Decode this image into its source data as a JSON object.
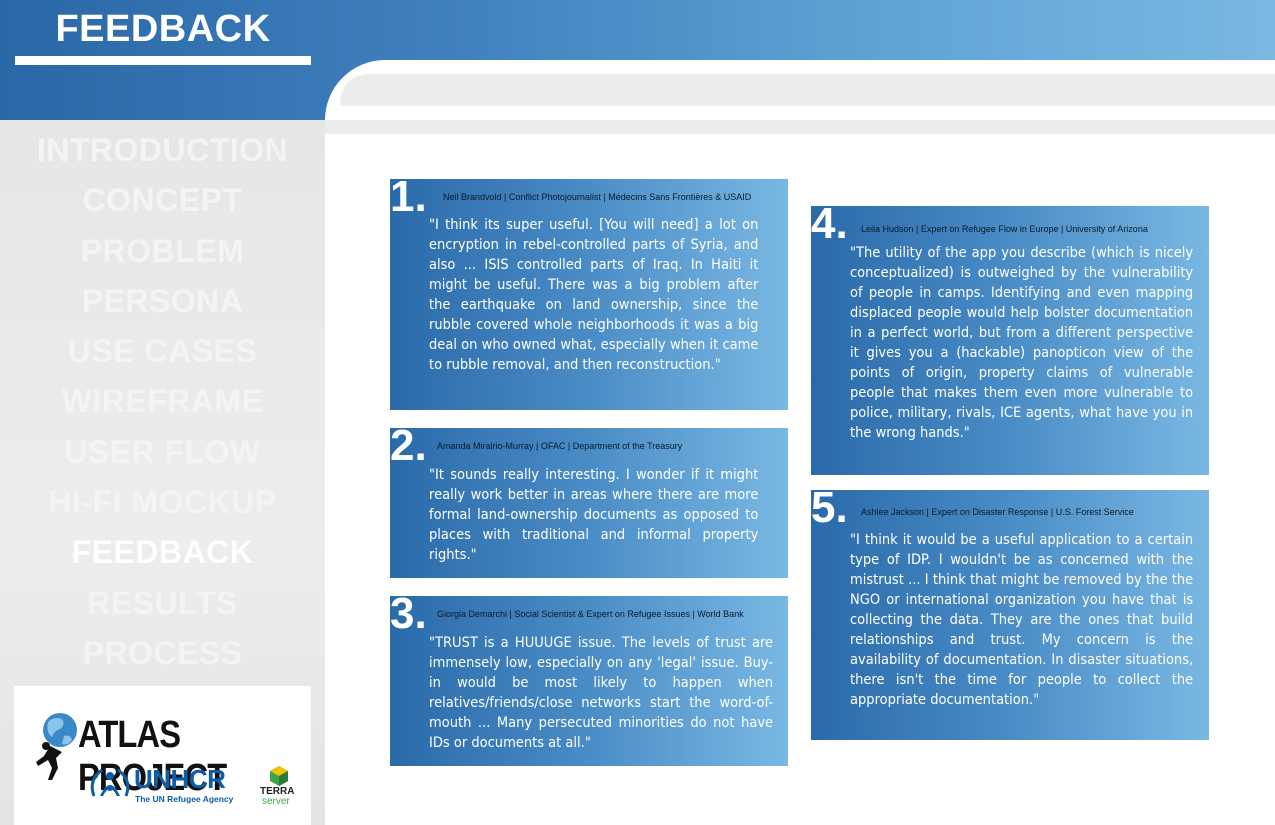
{
  "header": {
    "title": "FEEDBACK"
  },
  "sidebar": {
    "items": [
      {
        "label": "INTRODUCTION"
      },
      {
        "label": "CONCEPT"
      },
      {
        "label": "PROBLEM"
      },
      {
        "label": "PERSONA"
      },
      {
        "label": "USE CASES"
      },
      {
        "label": "WIREFRAME"
      },
      {
        "label": "USER FLOW"
      },
      {
        "label": "HI-FI MOCKUP"
      },
      {
        "label": "FEEDBACK",
        "active": true
      },
      {
        "label": "RESULTS"
      },
      {
        "label": "PROCESS"
      }
    ],
    "logos": {
      "atlas": "ATLAS PROJECT",
      "unhcr": "UNHCR",
      "unhcr_sub": "The UN Refugee Agency",
      "terra_line1": "TERRA",
      "terra_line2": "server"
    }
  },
  "colors": {
    "header_gradient_start": "#2a67a6",
    "header_gradient_end": "#7bb8e2",
    "card_gradient_start": "#2a6aa9",
    "card_gradient_end": "#7ab8e3",
    "sidebar_bg": "#e9e9e9",
    "unhcr_blue": "#0d5ea8"
  },
  "cards": [
    {
      "number": "1.",
      "meta": "Neil Brandvold  |  Conflict Photojournalist  |  Médecins Sans Frontières & USAID",
      "quote": "\"I think its super useful. [You will need] a lot on encryption in rebel-controlled parts of Syria, and also ... ISIS controlled parts of Iraq. In Haiti it might be useful. There was a big problem after the earthquake on land ownership, since the rubble covered whole neighborhoods it was a big deal on who owned what, especially when it came to rubble removal, and then reconstruction.\""
    },
    {
      "number": "2.",
      "meta": "Amanda Miralrio-Murray  |  OFAC  |  Department of the Treasury",
      "quote": "\"It sounds really interesting. I wonder if it might really work better in areas where there are more formal land-ownership documents as opposed to places with traditional and informal property rights.\""
    },
    {
      "number": "3.",
      "meta": "Giorgia Demarchi  |  Social Scientist & Expert on Refugee Issues  |  World Bank",
      "quote": "\"TRUST is a HUUUGE issue. The levels of trust are immensely low, especially on any 'legal' issue. Buy-in would be most likely to happen when relatives/friends/close networks start the word-of-mouth ... Many persecuted minorities do not have IDs or documents at all.\""
    },
    {
      "number": "4.",
      "meta": "Leila Hudson  |  Expert on Refugee Flow in Europe  |  University of Arizona",
      "quote": "\"The utility of the app you describe (which is nicely conceptualized) is outweighed by the vulnerability of people in camps. Identifying and even mapping displaced people would help bolster documentation in a perfect world, but from a different perspective it gives you a (hackable) panopticon view of the points of origin, property claims of vulnerable people that makes them even more vulnerable to police, military, rivals, ICE agents, what have you in the wrong hands.\""
    },
    {
      "number": "5.",
      "meta": "Ashlee Jackson  |  Expert on Disaster Response  |  U.S. Forest Service",
      "quote": "\"I think it would be a useful application to a certain type of IDP. I wouldn't be as concerned with the mistrust ... I think that might be removed by the the NGO or international organization you have that is collecting the data. They are the ones that build relationships and trust. My concern is the availability of documentation. In disaster situations, there isn't the time for people to collect the appropriate documentation.\""
    }
  ]
}
